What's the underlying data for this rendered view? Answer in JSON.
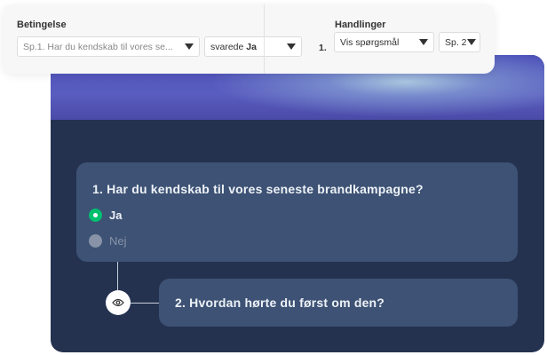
{
  "condition": {
    "label": "Betingelse",
    "question_select": "Sp.1. Har du kendskab til vores se...",
    "answer_prefix": "svarede",
    "answer_value": "Ja"
  },
  "actions": {
    "label": "Handlinger",
    "index": "1.",
    "action_select": "Vis spørgsmål",
    "target_select": "Sp. 2"
  },
  "survey": {
    "q1": {
      "title": "1. Har du kendskab til vores seneste brandkampagne?",
      "options": [
        {
          "label": "Ja",
          "selected": true
        },
        {
          "label": "Nej",
          "selected": false
        }
      ]
    },
    "q2": {
      "title": "2. Hvordan hørte du først om den?"
    },
    "logic_icon": "eye-icon"
  },
  "colors": {
    "accent": "#00bf6f",
    "panel": "#243250",
    "card": "#3d5274"
  }
}
